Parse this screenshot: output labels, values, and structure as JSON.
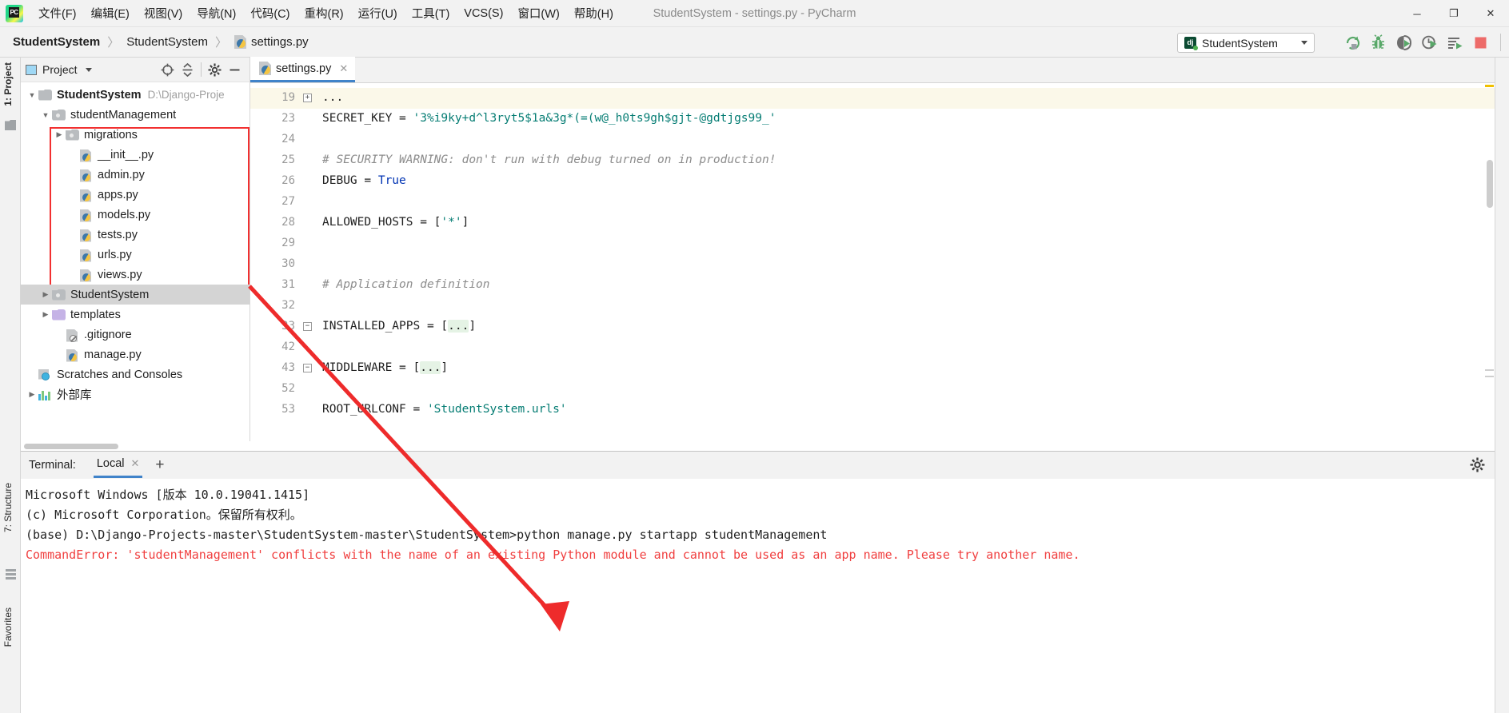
{
  "menubar": {
    "logo_text": "PC",
    "items": [
      {
        "label": "文件(F)"
      },
      {
        "label": "编辑(E)"
      },
      {
        "label": "视图(V)"
      },
      {
        "label": "导航(N)"
      },
      {
        "label": "代码(C)"
      },
      {
        "label": "重构(R)"
      },
      {
        "label": "运行(U)"
      },
      {
        "label": "工具(T)"
      },
      {
        "label": "VCS(S)"
      },
      {
        "label": "窗口(W)"
      },
      {
        "label": "帮助(H)"
      }
    ],
    "window_title": "StudentSystem - settings.py - PyCharm",
    "minimize": "─",
    "maximize": "❐",
    "close": "✕"
  },
  "navbar": {
    "breadcrumb": [
      {
        "label": "StudentSystem",
        "bold": true
      },
      {
        "label": "StudentSystem",
        "bold": false
      },
      {
        "label": "settings.py",
        "bold": false
      }
    ],
    "separator": "〉",
    "run_config": {
      "icon_text": "dj",
      "label": "StudentSystem"
    },
    "toolbar_icons": [
      {
        "name": "rerun-icon"
      },
      {
        "name": "debug-bug-icon"
      },
      {
        "name": "coverage-run-icon"
      },
      {
        "name": "profile-run-icon"
      },
      {
        "name": "run-with-console-icon"
      },
      {
        "name": "stop-icon"
      }
    ]
  },
  "left_stripe": {
    "tabs": [
      {
        "label": "1: Project",
        "active": true
      },
      {
        "label": "7: Structure",
        "active": false
      },
      {
        "label": "Favorites",
        "active": false
      }
    ]
  },
  "project_panel": {
    "title": "Project",
    "header_icons": [
      "locate-target-icon",
      "collapse-all-icon",
      "settings-gear-icon",
      "hide-panel-icon"
    ],
    "tree": [
      {
        "indent": 0,
        "arrow": "open",
        "icon": "folder",
        "label": "StudentSystem",
        "bold": true,
        "path": "D:\\Django-Proje",
        "selected": false
      },
      {
        "indent": 1,
        "arrow": "open",
        "icon": "folder-pkg",
        "label": "studentManagement",
        "bold": false,
        "path": "",
        "selected": false
      },
      {
        "indent": 2,
        "arrow": "closed",
        "icon": "folder-pkg",
        "label": "migrations",
        "bold": false,
        "path": "",
        "selected": false
      },
      {
        "indent": 3,
        "arrow": "none",
        "icon": "python-file",
        "label": "__init__.py",
        "bold": false,
        "path": "",
        "selected": false
      },
      {
        "indent": 3,
        "arrow": "none",
        "icon": "python-file",
        "label": "admin.py",
        "bold": false,
        "path": "",
        "selected": false
      },
      {
        "indent": 3,
        "arrow": "none",
        "icon": "python-file",
        "label": "apps.py",
        "bold": false,
        "path": "",
        "selected": false
      },
      {
        "indent": 3,
        "arrow": "none",
        "icon": "python-file",
        "label": "models.py",
        "bold": false,
        "path": "",
        "selected": false
      },
      {
        "indent": 3,
        "arrow": "none",
        "icon": "python-file",
        "label": "tests.py",
        "bold": false,
        "path": "",
        "selected": false
      },
      {
        "indent": 3,
        "arrow": "none",
        "icon": "python-file",
        "label": "urls.py",
        "bold": false,
        "path": "",
        "selected": false
      },
      {
        "indent": 3,
        "arrow": "none",
        "icon": "python-file",
        "label": "views.py",
        "bold": false,
        "path": "",
        "selected": false
      },
      {
        "indent": 1,
        "arrow": "closed",
        "icon": "folder-pkg",
        "label": "StudentSystem",
        "bold": false,
        "path": "",
        "selected": true
      },
      {
        "indent": 1,
        "arrow": "closed",
        "icon": "folder-purple",
        "label": "templates",
        "bold": false,
        "path": "",
        "selected": false
      },
      {
        "indent": 2,
        "arrow": "none",
        "icon": "git-file",
        "label": ".gitignore",
        "bold": false,
        "path": "",
        "selected": false
      },
      {
        "indent": 2,
        "arrow": "none",
        "icon": "python-file",
        "label": "manage.py",
        "bold": false,
        "path": "",
        "selected": false
      },
      {
        "indent": 0,
        "arrow": "none",
        "icon": "scratch",
        "label": "Scratches and Consoles",
        "bold": false,
        "path": "",
        "selected": false
      },
      {
        "indent": 0,
        "arrow": "closed",
        "icon": "library",
        "label": "外部库",
        "bold": false,
        "path": "",
        "selected": false
      }
    ]
  },
  "editor": {
    "tab": {
      "label": "settings.py",
      "close": "✕"
    },
    "lines": [
      {
        "num": "19",
        "fold": "plus",
        "highlight": true,
        "segments": [
          {
            "t": "...",
            "c": "plain"
          }
        ]
      },
      {
        "num": "23",
        "fold": "",
        "highlight": false,
        "segments": [
          {
            "t": "SECRET_KEY = ",
            "c": "plain"
          },
          {
            "t": "'3%i9ky+d^l3ryt5$1a&3g*(=(w@_h0ts9gh$gjt-@gdtjgs99_'",
            "c": "str"
          }
        ]
      },
      {
        "num": "24",
        "fold": "",
        "highlight": false,
        "segments": []
      },
      {
        "num": "25",
        "fold": "",
        "highlight": false,
        "segments": [
          {
            "t": "# SECURITY WARNING: don't run with debug turned on in production!",
            "c": "cmt"
          }
        ]
      },
      {
        "num": "26",
        "fold": "",
        "highlight": false,
        "segments": [
          {
            "t": "DEBUG = ",
            "c": "plain"
          },
          {
            "t": "True",
            "c": "kw"
          }
        ]
      },
      {
        "num": "27",
        "fold": "",
        "highlight": false,
        "segments": []
      },
      {
        "num": "28",
        "fold": "",
        "highlight": false,
        "segments": [
          {
            "t": "ALLOWED_HOSTS = [",
            "c": "plain"
          },
          {
            "t": "'*'",
            "c": "str"
          },
          {
            "t": "]",
            "c": "plain"
          }
        ]
      },
      {
        "num": "29",
        "fold": "",
        "highlight": false,
        "segments": []
      },
      {
        "num": "30",
        "fold": "",
        "highlight": false,
        "segments": []
      },
      {
        "num": "31",
        "fold": "",
        "highlight": false,
        "segments": [
          {
            "t": "# Application definition",
            "c": "cmt"
          }
        ]
      },
      {
        "num": "32",
        "fold": "",
        "highlight": false,
        "segments": []
      },
      {
        "num": "33",
        "fold": "minus",
        "highlight": false,
        "segments": [
          {
            "t": "INSTALLED_APPS = [",
            "c": "plain"
          },
          {
            "t": "...",
            "c": "fold"
          },
          {
            "t": "]",
            "c": "plain"
          }
        ]
      },
      {
        "num": "42",
        "fold": "",
        "highlight": false,
        "segments": []
      },
      {
        "num": "43",
        "fold": "minus",
        "highlight": false,
        "segments": [
          {
            "t": "MIDDLEWARE = [",
            "c": "plain"
          },
          {
            "t": "...",
            "c": "fold"
          },
          {
            "t": "]",
            "c": "plain"
          }
        ]
      },
      {
        "num": "52",
        "fold": "",
        "highlight": false,
        "segments": []
      },
      {
        "num": "53",
        "fold": "",
        "highlight": false,
        "segments": [
          {
            "t": "ROOT_URLCONF = ",
            "c": "plain"
          },
          {
            "t": "'StudentSystem.urls'",
            "c": "str"
          }
        ]
      }
    ]
  },
  "terminal": {
    "title": "Terminal:",
    "tab": {
      "label": "Local",
      "close": "✕"
    },
    "add_label": "+",
    "settings_icon": "gear-icon",
    "lines": [
      {
        "text": "Microsoft Windows [版本 10.0.19041.1415]",
        "error": false
      },
      {
        "text": "(c) Microsoft Corporation。保留所有权利。",
        "error": false
      },
      {
        "text": "",
        "error": false
      },
      {
        "text": "(base) D:\\Django-Projects-master\\StudentSystem-master\\StudentSystem>python manage.py startapp studentManagement",
        "error": false
      },
      {
        "text": "CommandError: 'studentManagement' conflicts with the name of an existing Python module and cannot be used as an app name. Please try another name.",
        "error": true
      }
    ]
  },
  "annotations": {
    "highlight_box_color": "#f23030",
    "arrow_color": "#ee2b2b"
  }
}
